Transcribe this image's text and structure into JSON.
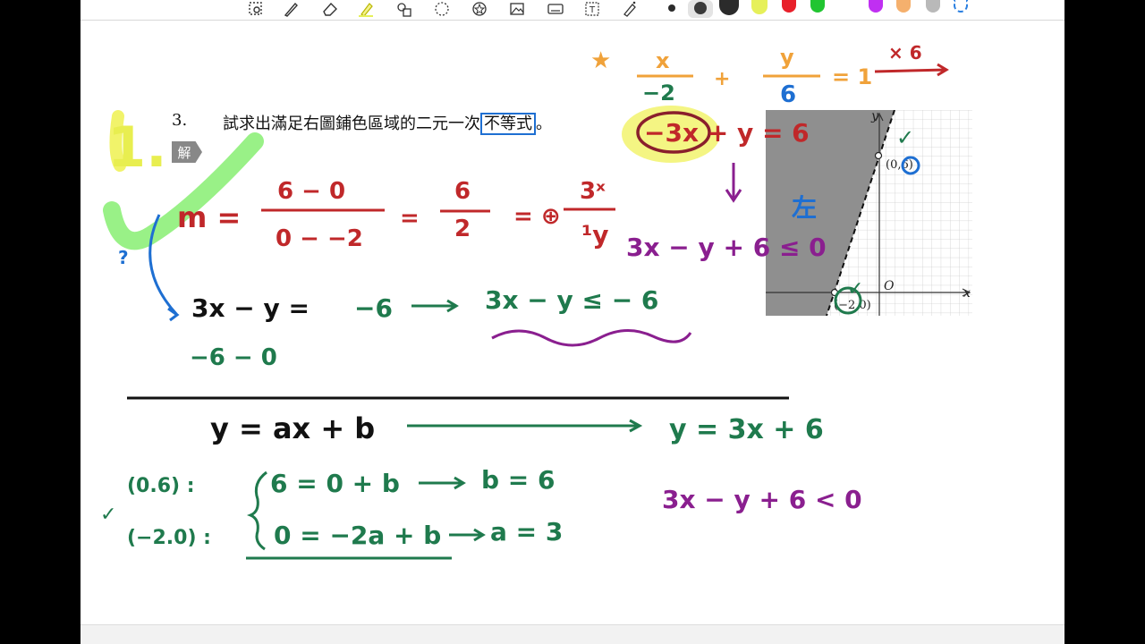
{
  "toolbar": {
    "tools": [
      "lasso-tool-icon",
      "pen-icon",
      "eraser-icon",
      "highlighter-icon",
      "shapes-icon",
      "lasso-select-icon",
      "sticker-icon",
      "image-icon",
      "keyboard-icon",
      "text-box-icon",
      "magic-pen-icon"
    ],
    "colors": [
      "#2b2b2b",
      "#3a3a3a",
      "#e6f05a",
      "#e8202a",
      "#21c531",
      "#c02ff2",
      "#f5b06d",
      "#b9b9b9",
      "#2a7fe0"
    ]
  },
  "problem": {
    "number": "3.",
    "text_before": "試求出滿足右圖鋪色區域的二元一次",
    "text_boxed": "不等式",
    "text_after": "。",
    "solution_tag": "解"
  },
  "graph": {
    "y_axis": "y",
    "x_axis": "x",
    "origin": "O",
    "point_top": "(0,6)",
    "point_left": "(−2,0)"
  },
  "ink": {
    "top_eq": {
      "star": "★",
      "x": "x",
      "den1": "−2",
      "plus": "+",
      "y": "y",
      "den2": "6",
      "eq1": "= 1",
      "arrow_label": "× 6"
    },
    "big_one": "1.",
    "line_eq": "−3x + y = 6",
    "left_label": "左",
    "ineq_purple": "3x − y + 6 ≤ 0",
    "m_label": "m =",
    "m_num1": "6 − 0",
    "m_den1": "0 − −2",
    "eq_a": "=",
    "m_num2": "6",
    "m_den2": "2",
    "eq_b": "= ⊕",
    "m_num3": "3ˣ",
    "m_den3": "¹y",
    "question": "?",
    "eq_line": "3x − y = ",
    "eq_rhs": "−6",
    "eq_result": "3x − y ≤ − 6",
    "sub_line": "−6 − 0",
    "eq_general": "y = ax + b",
    "eq_final": "y = 3x + 6",
    "pt1": "(0.6) :",
    "pt2": "(−2.0) :",
    "sys1": "6 = 0 + b",
    "sys2": "0 = −2a + b",
    "b_result": "b = 6",
    "a_result": "a = 3",
    "ineq_final": "3x − y + 6 < 0",
    "check": "✓"
  }
}
